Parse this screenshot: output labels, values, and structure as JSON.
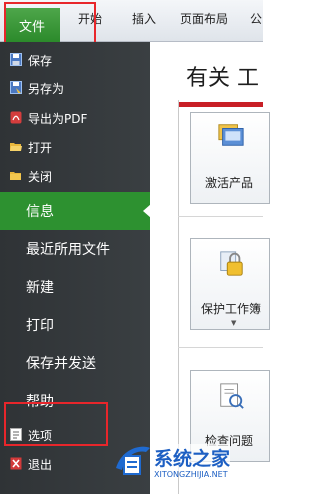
{
  "ribbon": {
    "tabs": [
      "文件",
      "开始",
      "插入",
      "页面布局",
      "公"
    ]
  },
  "backstage": {
    "commands_top": [
      {
        "label": "保存",
        "icon": "save-icon"
      },
      {
        "label": "另存为",
        "icon": "save-as-icon"
      },
      {
        "label": "导出为PDF",
        "icon": "pdf-icon"
      },
      {
        "label": "打开",
        "icon": "open-folder-icon"
      },
      {
        "label": "关闭",
        "icon": "close-folder-icon"
      }
    ],
    "sections": [
      "信息",
      "最近所用文件",
      "新建",
      "打印",
      "保存并发送",
      "帮助"
    ],
    "commands_bottom": [
      {
        "label": "选项",
        "icon": "options-icon"
      },
      {
        "label": "退出",
        "icon": "exit-icon"
      }
    ]
  },
  "content": {
    "heading": "有关 工",
    "buttons": [
      "激活产品",
      "保护工作簿",
      "检查问题"
    ]
  },
  "watermark": {
    "title": "系统之家",
    "url": "XITONGZHIJIA.NET"
  },
  "colors": {
    "file_tab": "#2c8a2b",
    "active_section": "#2d9130",
    "nav_bg": "#33373a",
    "highlight": "#e8262b",
    "accent_strip": "#c81f26"
  }
}
